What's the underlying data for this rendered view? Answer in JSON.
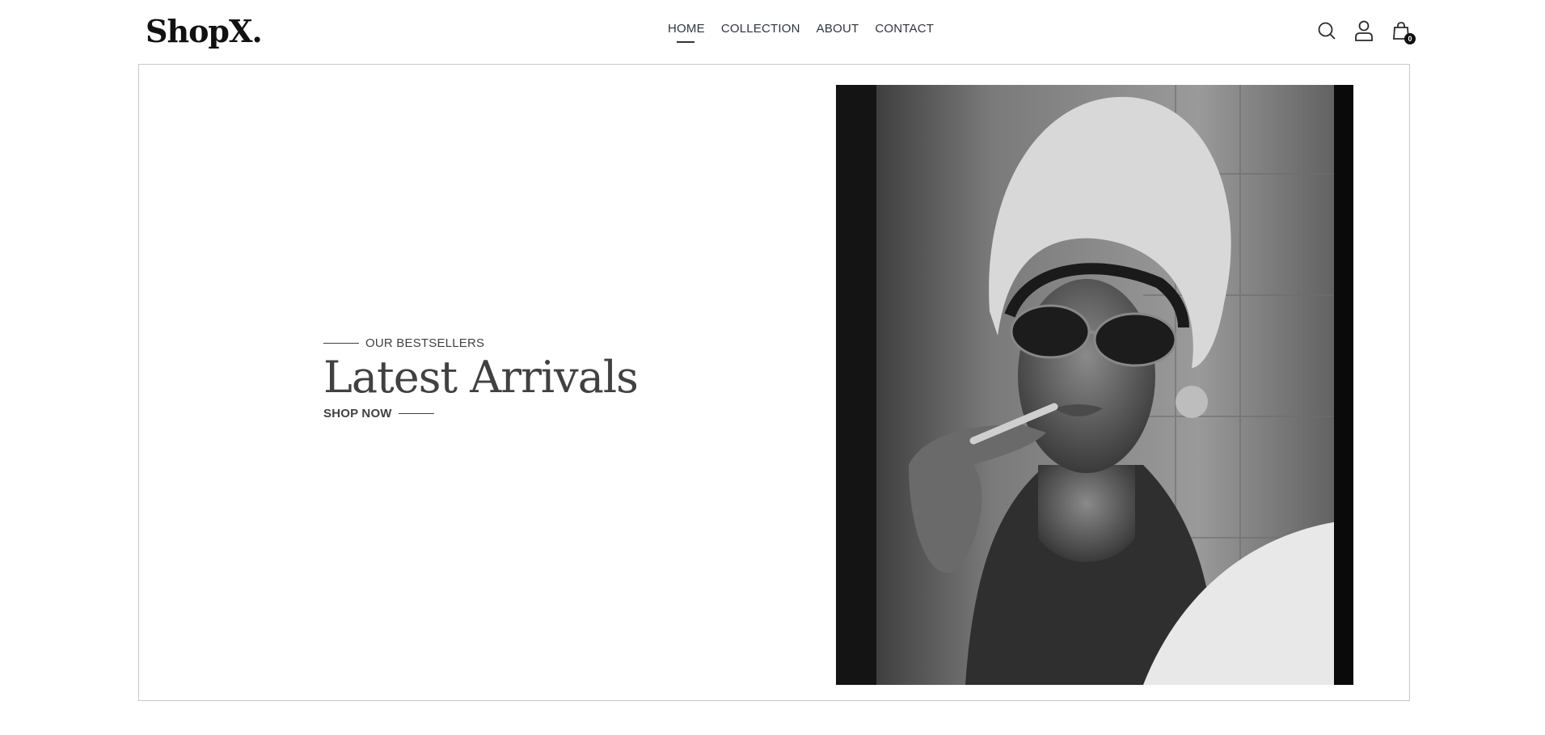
{
  "brand": {
    "name": "ShopX."
  },
  "nav": {
    "links": [
      {
        "label": "HOME",
        "active": true
      },
      {
        "label": "COLLECTION",
        "active": false
      },
      {
        "label": "ABOUT",
        "active": false
      },
      {
        "label": "CONTACT",
        "active": false
      }
    ]
  },
  "header_icons": {
    "search": "search-icon",
    "profile": "user-icon",
    "cart": "shopping-bag-icon",
    "cart_count": "0"
  },
  "hero": {
    "eyebrow": "OUR BESTSELLERS",
    "title": "Latest Arrivals",
    "cta": "SHOP NOW",
    "image_description_icon": "model-portrait-image"
  },
  "colors": {
    "text_dark": "#414141",
    "nav_text": "#2f3440",
    "border": "#c8c8c8",
    "accent": "#111111"
  }
}
